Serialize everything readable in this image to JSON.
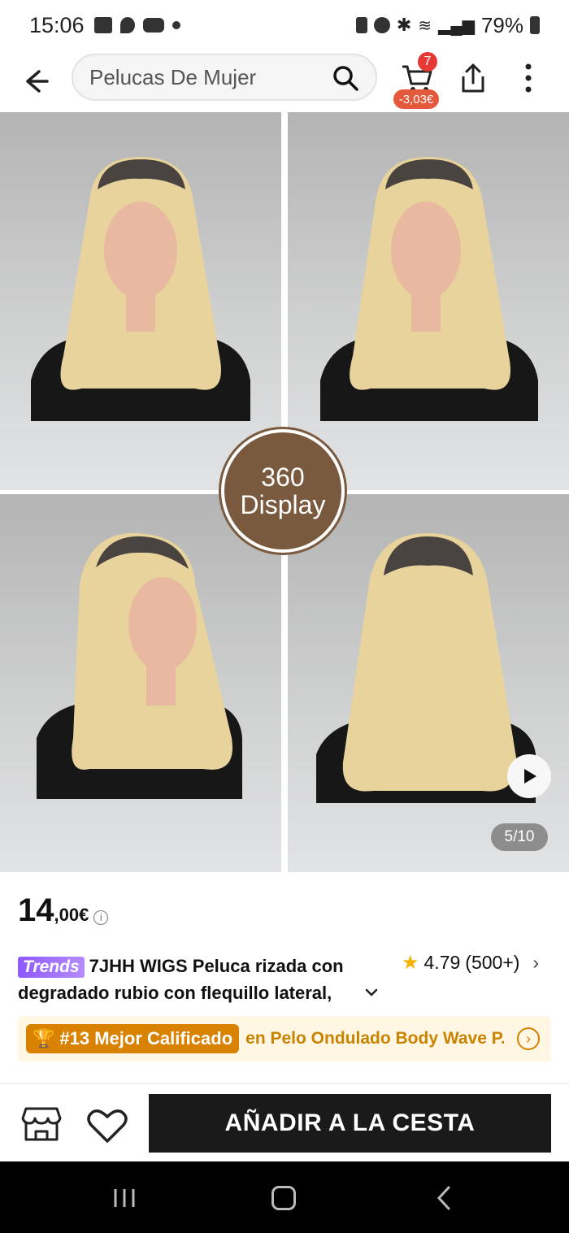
{
  "status_bar": {
    "time": "15:06",
    "battery": "79%"
  },
  "header": {
    "search_text": "Pelucas De Mujer",
    "cart_count": "7",
    "cart_discount": "-3,03€"
  },
  "gallery": {
    "display_badge_line1": "360",
    "display_badge_line2": "Display",
    "counter": "5/10"
  },
  "product": {
    "price_int": "14",
    "price_dec": ",00€",
    "trends_label": "Trends",
    "title": "7JHH WIGS Peluca rizada con degradado rubio con flequillo lateral,",
    "rating": "4.79",
    "rating_count": "(500+)"
  },
  "ranking": {
    "tag": "#13 Mejor Calificado",
    "category": "en Pelo Ondulado Body Wave P..."
  },
  "actions": {
    "add_to_cart": "AÑADIR A LA CESTA"
  },
  "colors": {
    "accent_brown": "#7a5a3f",
    "trends_purple": "#8e59ff",
    "rank_orange": "#d98200",
    "cart_badge": "#e53935"
  }
}
